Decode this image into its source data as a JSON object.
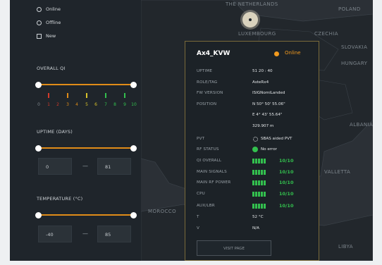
{
  "filters": {
    "radio_online": "Online",
    "radio_offline": "Offline",
    "radio_new": "New",
    "overall_qi_label": "OVERALL QI",
    "tick_numbers": [
      "0",
      "1",
      "2",
      "3",
      "4",
      "5",
      "6",
      "7",
      "8",
      "9",
      "10"
    ],
    "uptime_label": "UPTIME (DAYS)",
    "uptime_min": "0",
    "uptime_max": "81",
    "temperature_label": "TEMPERATURE (°C)",
    "temperature_min": "-40",
    "temperature_max": "85",
    "range_separator": "—"
  },
  "map": {
    "labels": {
      "netherlands": "THE NETHERLANDS",
      "poland": "POLAND",
      "luxembourg": "LUXEMBOURG",
      "czechia": "CZECHIA",
      "slovakia": "SLOVAKIA",
      "hungary": "HUNGARY",
      "albania": "ALBANIA",
      "valletta": "VALLETTA",
      "morocco": "MOROCCO",
      "libya": "LIBYA"
    }
  },
  "popup": {
    "title": "Ax4_KVW",
    "status": "Online",
    "uptime_key": "UPTIME",
    "uptime_val": "51 20 : 40",
    "role_key": "ROLE/TAG",
    "role_val": "AsteRx4",
    "fw_key": "FW VERSION",
    "fw_val": "ISIGNomiLanded",
    "position_key": "POSITION",
    "position_lat": "N 50° 50' 55.06\"",
    "position_lon": "E 4° 43' 55.64\"",
    "position_alt": "329.907 m",
    "pvt_key": "PVT",
    "pvt_val": "SBAS aided PVT",
    "rf_key": "RF STATUS",
    "rf_val": "No error",
    "qi_overall_key": "QI OVERALL",
    "qi_overall_val": "10/10",
    "main_signals_key": "MAIN SIGNALS",
    "main_signals_val": "10/10",
    "main_power_key": "MAIN RF POWER",
    "main_power_val": "10/10",
    "cpu_key": "CPU",
    "cpu_val": "10/10",
    "aux_key": "AUX/LBR",
    "aux_val": "10/10",
    "temp_key": "T",
    "temp_val": "52 °C",
    "v_key": "V",
    "v_val": "N/A",
    "button": "VISIT PAGE"
  },
  "colors": {
    "accent": "#e08c18",
    "status_online": "#f29a1e",
    "signal_green": "#33c04e"
  }
}
